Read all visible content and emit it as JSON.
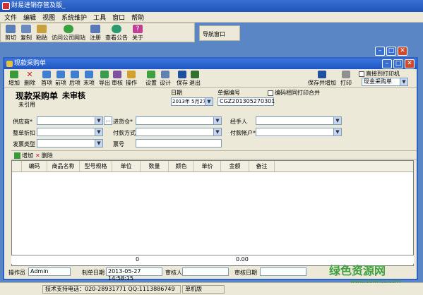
{
  "app": {
    "title": "财易进销存管及版_"
  },
  "menu": [
    "文件",
    "编辑",
    "视图",
    "系统维护",
    "工具",
    "窗口",
    "帮助"
  ],
  "toolbar": {
    "cut": "剪切",
    "copy": "复制",
    "paste": "粘贴",
    "visit": "访问公司网站",
    "register": "注册",
    "notice": "查看公告",
    "about": "关于",
    "nav": "导航窗口"
  },
  "window": {
    "title": "现款采购单"
  },
  "ctool": {
    "add": "增加",
    "delete": "删除",
    "first": "首项",
    "prev": "前项",
    "next": "后项",
    "last": "末项",
    "export": "导出",
    "audit": "审核",
    "operate": "操作",
    "settings": "设置",
    "design": "设计",
    "save": "保存",
    "exit": "退出",
    "save_add": "保存并增加",
    "print": "打印",
    "direct_print": "直接到打印机",
    "print_format": "现金采购单"
  },
  "form": {
    "doc_title": "现款采购单",
    "status": "未审核",
    "ref": "未引用",
    "date_label": "日期",
    "date_value": "2013年 5月27日",
    "docno_label": "单据编号",
    "docno_value": "CGZ201305270301",
    "merge_print": "编码相同打印合并",
    "supplier": "供应商*",
    "warehouse": "进货仓*",
    "handler": "经手人",
    "discount": "整单折扣",
    "paymethod": "付款方式*",
    "payaccount": "付款帐户*",
    "invoice": "发票类型",
    "ticketno": "票号"
  },
  "grid": {
    "add": "增加",
    "delete": "删除",
    "columns": [
      "编码",
      "商品名称",
      "型号规格",
      "单位",
      "数量",
      "颜色",
      "单价",
      "金额",
      "备注"
    ],
    "total_qty": "0",
    "total_amount": "0.00"
  },
  "footer": {
    "operator_label": "操作员",
    "operator_value": "Admin",
    "made_date_label": "制单日期",
    "made_date_value": "2013-05-27 14:58:15",
    "auditor_label": "审核人",
    "audit_date_label": "审核日期"
  },
  "status": {
    "support": "技术支持电话：020-28931771 QQ:1113886749",
    "edition": "单机版"
  },
  "watermark": {
    "text": "绿色资源网",
    "sub": "www.downcc.com"
  }
}
